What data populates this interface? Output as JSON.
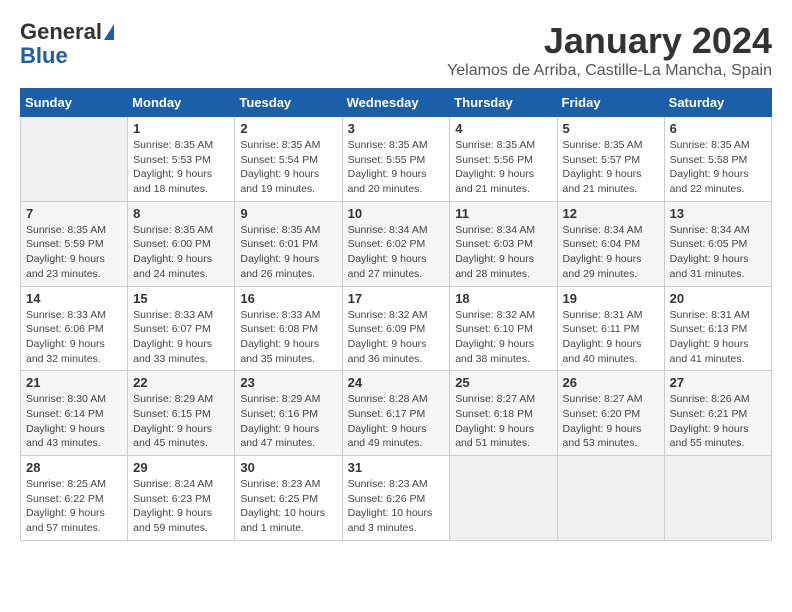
{
  "logo": {
    "general": "General",
    "blue": "Blue"
  },
  "title": "January 2024",
  "location": "Yelamos de Arriba, Castille-La Mancha, Spain",
  "days_of_week": [
    "Sunday",
    "Monday",
    "Tuesday",
    "Wednesday",
    "Thursday",
    "Friday",
    "Saturday"
  ],
  "weeks": [
    [
      {
        "day": "",
        "info": ""
      },
      {
        "day": "1",
        "info": "Sunrise: 8:35 AM\nSunset: 5:53 PM\nDaylight: 9 hours\nand 18 minutes."
      },
      {
        "day": "2",
        "info": "Sunrise: 8:35 AM\nSunset: 5:54 PM\nDaylight: 9 hours\nand 19 minutes."
      },
      {
        "day": "3",
        "info": "Sunrise: 8:35 AM\nSunset: 5:55 PM\nDaylight: 9 hours\nand 20 minutes."
      },
      {
        "day": "4",
        "info": "Sunrise: 8:35 AM\nSunset: 5:56 PM\nDaylight: 9 hours\nand 21 minutes."
      },
      {
        "day": "5",
        "info": "Sunrise: 8:35 AM\nSunset: 5:57 PM\nDaylight: 9 hours\nand 21 minutes."
      },
      {
        "day": "6",
        "info": "Sunrise: 8:35 AM\nSunset: 5:58 PM\nDaylight: 9 hours\nand 22 minutes."
      }
    ],
    [
      {
        "day": "7",
        "info": "Sunrise: 8:35 AM\nSunset: 5:59 PM\nDaylight: 9 hours\nand 23 minutes."
      },
      {
        "day": "8",
        "info": "Sunrise: 8:35 AM\nSunset: 6:00 PM\nDaylight: 9 hours\nand 24 minutes."
      },
      {
        "day": "9",
        "info": "Sunrise: 8:35 AM\nSunset: 6:01 PM\nDaylight: 9 hours\nand 26 minutes."
      },
      {
        "day": "10",
        "info": "Sunrise: 8:34 AM\nSunset: 6:02 PM\nDaylight: 9 hours\nand 27 minutes."
      },
      {
        "day": "11",
        "info": "Sunrise: 8:34 AM\nSunset: 6:03 PM\nDaylight: 9 hours\nand 28 minutes."
      },
      {
        "day": "12",
        "info": "Sunrise: 8:34 AM\nSunset: 6:04 PM\nDaylight: 9 hours\nand 29 minutes."
      },
      {
        "day": "13",
        "info": "Sunrise: 8:34 AM\nSunset: 6:05 PM\nDaylight: 9 hours\nand 31 minutes."
      }
    ],
    [
      {
        "day": "14",
        "info": "Sunrise: 8:33 AM\nSunset: 6:06 PM\nDaylight: 9 hours\nand 32 minutes."
      },
      {
        "day": "15",
        "info": "Sunrise: 8:33 AM\nSunset: 6:07 PM\nDaylight: 9 hours\nand 33 minutes."
      },
      {
        "day": "16",
        "info": "Sunrise: 8:33 AM\nSunset: 6:08 PM\nDaylight: 9 hours\nand 35 minutes."
      },
      {
        "day": "17",
        "info": "Sunrise: 8:32 AM\nSunset: 6:09 PM\nDaylight: 9 hours\nand 36 minutes."
      },
      {
        "day": "18",
        "info": "Sunrise: 8:32 AM\nSunset: 6:10 PM\nDaylight: 9 hours\nand 38 minutes."
      },
      {
        "day": "19",
        "info": "Sunrise: 8:31 AM\nSunset: 6:11 PM\nDaylight: 9 hours\nand 40 minutes."
      },
      {
        "day": "20",
        "info": "Sunrise: 8:31 AM\nSunset: 6:13 PM\nDaylight: 9 hours\nand 41 minutes."
      }
    ],
    [
      {
        "day": "21",
        "info": "Sunrise: 8:30 AM\nSunset: 6:14 PM\nDaylight: 9 hours\nand 43 minutes."
      },
      {
        "day": "22",
        "info": "Sunrise: 8:29 AM\nSunset: 6:15 PM\nDaylight: 9 hours\nand 45 minutes."
      },
      {
        "day": "23",
        "info": "Sunrise: 8:29 AM\nSunset: 6:16 PM\nDaylight: 9 hours\nand 47 minutes."
      },
      {
        "day": "24",
        "info": "Sunrise: 8:28 AM\nSunset: 6:17 PM\nDaylight: 9 hours\nand 49 minutes."
      },
      {
        "day": "25",
        "info": "Sunrise: 8:27 AM\nSunset: 6:18 PM\nDaylight: 9 hours\nand 51 minutes."
      },
      {
        "day": "26",
        "info": "Sunrise: 8:27 AM\nSunset: 6:20 PM\nDaylight: 9 hours\nand 53 minutes."
      },
      {
        "day": "27",
        "info": "Sunrise: 8:26 AM\nSunset: 6:21 PM\nDaylight: 9 hours\nand 55 minutes."
      }
    ],
    [
      {
        "day": "28",
        "info": "Sunrise: 8:25 AM\nSunset: 6:22 PM\nDaylight: 9 hours\nand 57 minutes."
      },
      {
        "day": "29",
        "info": "Sunrise: 8:24 AM\nSunset: 6:23 PM\nDaylight: 9 hours\nand 59 minutes."
      },
      {
        "day": "30",
        "info": "Sunrise: 8:23 AM\nSunset: 6:25 PM\nDaylight: 10 hours\nand 1 minute."
      },
      {
        "day": "31",
        "info": "Sunrise: 8:23 AM\nSunset: 6:26 PM\nDaylight: 10 hours\nand 3 minutes."
      },
      {
        "day": "",
        "info": ""
      },
      {
        "day": "",
        "info": ""
      },
      {
        "day": "",
        "info": ""
      }
    ]
  ]
}
